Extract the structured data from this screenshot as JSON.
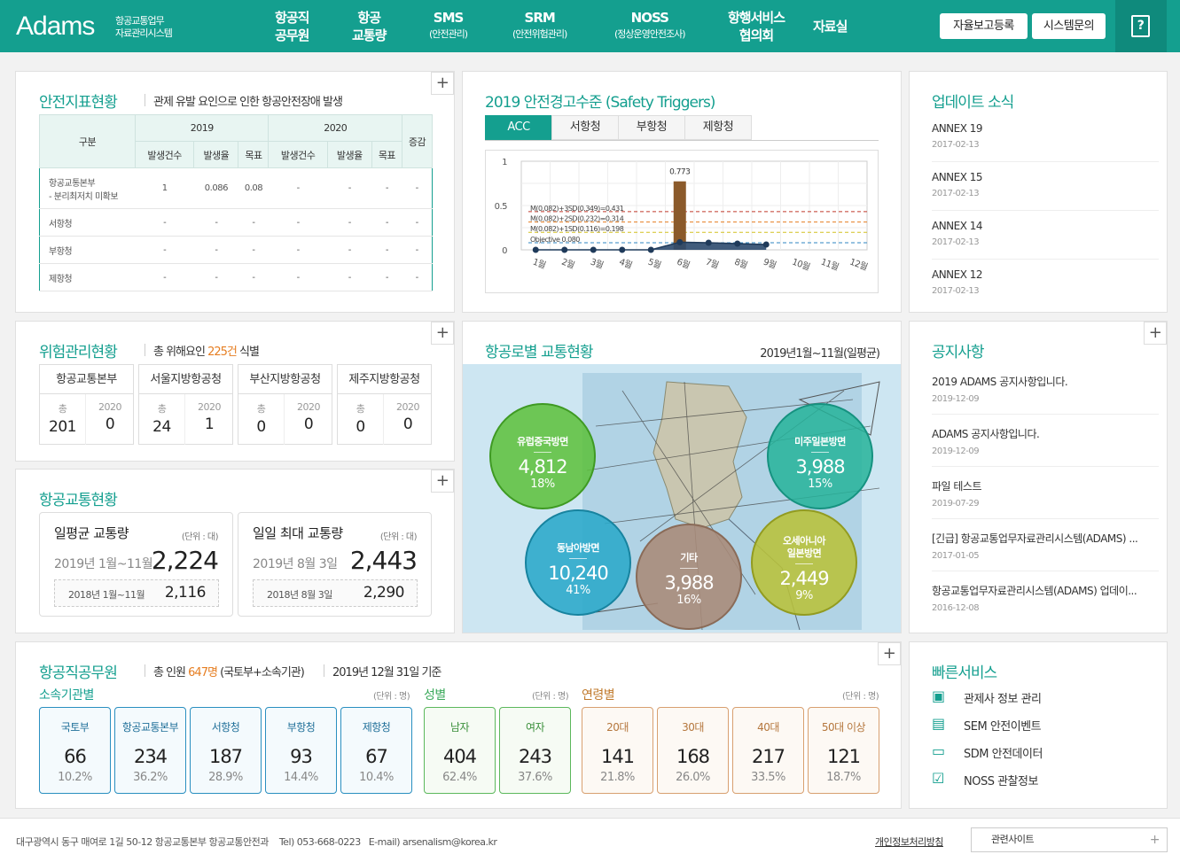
{
  "header": {
    "logo": "Adams",
    "logo_sub1": "항공교통업무",
    "logo_sub2": "자료관리시스템",
    "nav": [
      {
        "l1": "항공직",
        "l2": "공무원"
      },
      {
        "l1": "항공",
        "l2": "교통량"
      },
      {
        "l1": "SMS",
        "sub": "(안전관리)"
      },
      {
        "l1": "SRM",
        "sub": "(안전위험관리)"
      },
      {
        "l1": "NOSS",
        "sub": "(정상운영안전조사)"
      },
      {
        "l1": "항행서비스",
        "l2": "협의회"
      },
      {
        "l1": "자료실"
      }
    ],
    "btn_report": "자율보고등록",
    "btn_inquiry": "시스템문의",
    "help_icon": "?"
  },
  "safety": {
    "title": "안전지표현황",
    "subtitle": "관제 유발 요인으로 인한 항공안전장애 발생",
    "head": {
      "gubun": "구분",
      "y2019": "2019",
      "y2020": "2020",
      "change": "증감",
      "c1": "발생건수",
      "c2": "발생율",
      "c3": "목표"
    },
    "rows": [
      {
        "l1": "항공교통본부",
        "l2": "- 분리최저치 미확보",
        "v": [
          "1",
          "0.086",
          "0.08",
          "-",
          "-",
          "-",
          "-"
        ]
      },
      {
        "l1": "서항청",
        "v": [
          "-",
          "-",
          "-",
          "-",
          "-",
          "-",
          "-"
        ]
      },
      {
        "l1": "부항청",
        "v": [
          "-",
          "-",
          "-",
          "-",
          "-",
          "-",
          "-"
        ]
      },
      {
        "l1": "제항청",
        "v": [
          "-",
          "-",
          "-",
          "-",
          "-",
          "-",
          "-"
        ]
      }
    ]
  },
  "triggers": {
    "title": "2019 안전경고수준 (Safety Triggers)",
    "tabs": [
      "ACC",
      "서항청",
      "부항청",
      "제항청"
    ]
  },
  "chart_data": {
    "type": "bar",
    "title": "2019 안전경고수준 (Safety Triggers)",
    "categories": [
      "1월",
      "2월",
      "3월",
      "4월",
      "5월",
      "6월",
      "7월",
      "8월",
      "9월",
      "10월",
      "11월",
      "12월"
    ],
    "bar_values": [
      0,
      0,
      0,
      0,
      0,
      0.773,
      0,
      0,
      0,
      null,
      null,
      null
    ],
    "bar_label": "0.773",
    "line_values": [
      0,
      0,
      0,
      0,
      0,
      0.086,
      0.08,
      0.07,
      0.06,
      null,
      null,
      null
    ],
    "ylim": [
      0,
      1
    ],
    "yticks": [
      "0",
      "0.5",
      "1"
    ],
    "thresholds": [
      {
        "label": "M(0.082)+3SD(0.349)=0.431",
        "value": 0.431,
        "color": "#c0392b"
      },
      {
        "label": "M(0.082)+2SD(0.232)=0.314",
        "value": 0.314,
        "color": "#e67e22"
      },
      {
        "label": "M(0.082)+1SD(0.116)=0.198",
        "value": 0.198,
        "color": "#d4c020"
      },
      {
        "label": "Objective 0.080",
        "value": 0.08,
        "color": "#2e86c1"
      }
    ],
    "colors": {
      "bar": "#8b5a2b",
      "area": "#2c4a6e"
    }
  },
  "updates": {
    "title": "업데이트 소식",
    "items": [
      {
        "t": "ANNEX 19",
        "d": "2017-02-13"
      },
      {
        "t": "ANNEX 15",
        "d": "2017-02-13"
      },
      {
        "t": "ANNEX 14",
        "d": "2017-02-13"
      },
      {
        "t": "ANNEX 12",
        "d": "2017-02-13"
      }
    ]
  },
  "risk": {
    "title": "위험관리현황",
    "sub_pre": "총 위해요인 ",
    "sub_count": "225건",
    "sub_post": " 식별",
    "total_label": "총",
    "year_label": "2020",
    "boxes": [
      {
        "name": "항공교통본부",
        "total": "201",
        "y": "0"
      },
      {
        "name": "서울지방항공청",
        "total": "24",
        "y": "1"
      },
      {
        "name": "부산지방항공청",
        "total": "0",
        "y": "0"
      },
      {
        "name": "제주지방항공청",
        "total": "0",
        "y": "0"
      }
    ]
  },
  "traffic": {
    "title": "항공교통현황",
    "unit": "(단위 : 대)",
    "avg": {
      "title": "일평균 교통량",
      "period": "2019년 1월~11월",
      "value": "2,224",
      "prev_period": "2018년 1월~11월",
      "prev_value": "2,116"
    },
    "max": {
      "title": "일일 최대 교통량",
      "period": "2019년 8월 3일",
      "value": "2,443",
      "prev_period": "2018년 8월 3일",
      "prev_value": "2,290"
    }
  },
  "route": {
    "title": "항공로별 교통현황",
    "period": "2019년1월~11월(일평균)",
    "circles": [
      {
        "name": "유럽중국방면",
        "value": "4,812",
        "pct": "18%",
        "color": "#5cbf3a"
      },
      {
        "name": "미주일본방면",
        "value": "3,988",
        "pct": "15%",
        "color": "#26b39a"
      },
      {
        "name": "동남아방면",
        "value": "10,240",
        "pct": "41%",
        "color": "#2aa8c9"
      },
      {
        "name": "기타",
        "value": "3,988",
        "pct": "16%",
        "color": "#a88a78"
      },
      {
        "name": "오세아니아 일본방면",
        "n1": "오세아니아",
        "n2": "일본방면",
        "value": "2,449",
        "pct": "9%",
        "color": "#b8c23a"
      }
    ]
  },
  "notices": {
    "title": "공지사항",
    "items": [
      {
        "t": "2019 ADAMS 공지사항입니다.",
        "d": "2019-12-09"
      },
      {
        "t": "ADAMS 공지사항입니다.",
        "d": "2019-12-09"
      },
      {
        "t": "파일 테스트",
        "d": "2019-07-29"
      },
      {
        "t": "[긴급] 항공교통업무자료관리시스템(ADAMS) ...",
        "d": "2017-01-05"
      },
      {
        "t": "항공교통업무자료관리시스템(ADAMS) 업데이...",
        "d": "2016-12-08"
      }
    ]
  },
  "staff": {
    "title": "항공직공무원",
    "sub_pre": "총 인원 ",
    "sub_count": "647명",
    "sub_post": " (국토부+소속기관)",
    "date": "2019년 12월 31일 기준",
    "unit": "(단위 : 명)",
    "g1": {
      "title": "소속기관별",
      "items": [
        {
          "l": "국토부",
          "v": "66",
          "p": "10.2%"
        },
        {
          "l": "항공교통본부",
          "v": "234",
          "p": "36.2%"
        },
        {
          "l": "서항청",
          "v": "187",
          "p": "28.9%"
        },
        {
          "l": "부항청",
          "v": "93",
          "p": "14.4%"
        },
        {
          "l": "제항청",
          "v": "67",
          "p": "10.4%"
        }
      ]
    },
    "g2": {
      "title": "성별",
      "items": [
        {
          "l": "남자",
          "v": "404",
          "p": "62.4%"
        },
        {
          "l": "여자",
          "v": "243",
          "p": "37.6%"
        }
      ]
    },
    "g3": {
      "title": "연령별",
      "items": [
        {
          "l": "20대",
          "v": "141",
          "p": "21.8%"
        },
        {
          "l": "30대",
          "v": "168",
          "p": "26.0%"
        },
        {
          "l": "40대",
          "v": "217",
          "p": "33.5%"
        },
        {
          "l": "50대 이상",
          "v": "121",
          "p": "18.7%"
        }
      ]
    }
  },
  "quick": {
    "title": "빠른서비스",
    "items": [
      {
        "l": "관제사 정보 관리",
        "icon": "id-card-icon"
      },
      {
        "l": "SEM 안전이벤트",
        "icon": "chat-icon"
      },
      {
        "l": "SDM 안전데이터",
        "icon": "monitor-icon"
      },
      {
        "l": "NOSS 관찰정보",
        "icon": "checklist-icon"
      }
    ]
  },
  "footer": {
    "address": "대구광역시 동구 매여로 1길 50-12 항공교통본부 항공교통안전과",
    "tel": "Tel) 053-668-0223",
    "email": "E-mail) arsenalism@korea.kr",
    "privacy": "개인정보처리방침",
    "related": "관련사이트",
    "plus": "+"
  },
  "plus": "+"
}
